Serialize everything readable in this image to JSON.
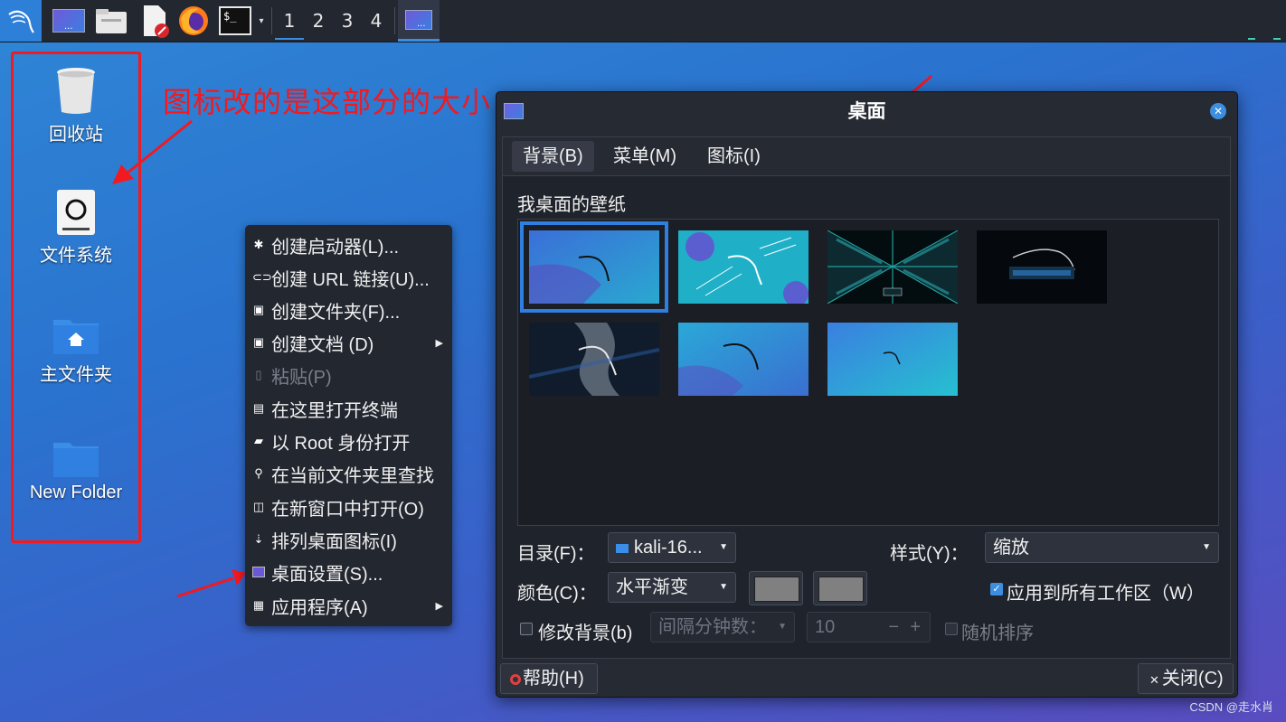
{
  "taskbar": {
    "workspaces": [
      "1",
      "2",
      "3",
      "4"
    ],
    "active_workspace": "1",
    "terminal_label": "$_"
  },
  "desktop": {
    "icons": [
      {
        "label": "回收站",
        "icon": "trash-icon"
      },
      {
        "label": "文件系统",
        "icon": "drive-icon"
      },
      {
        "label": "主文件夹",
        "icon": "home-folder-icon"
      },
      {
        "label": "New Folder",
        "icon": "folder-icon"
      }
    ],
    "annotation": "图标改的是这部分的大小",
    "annotation_color": "#f2191f"
  },
  "context_menu": {
    "items": [
      {
        "label": "创建启动器(L)...",
        "icon": "gear-icon"
      },
      {
        "label": "创建 URL 链接(U)...",
        "icon": "link-icon"
      },
      {
        "label": "创建文件夹(F)...",
        "icon": "new-folder-icon"
      },
      {
        "label": "创建文档 (D)",
        "icon": "new-document-icon",
        "submenu": true
      },
      {
        "label": "粘贴(P)",
        "icon": "paste-icon",
        "disabled": true
      },
      {
        "label": "在这里打开终端",
        "icon": "terminal-icon"
      },
      {
        "label": "以 Root 身份打开",
        "icon": "folder-icon"
      },
      {
        "label": "在当前文件夹里查找",
        "icon": "search-icon"
      },
      {
        "label": "在新窗口中打开(O)",
        "icon": "window-icon"
      },
      {
        "label": "排列桌面图标(I)",
        "icon": "arrange-icon"
      },
      {
        "label": "桌面设置(S)...",
        "icon": "desktop-settings-icon"
      },
      {
        "label": "应用程序(A)",
        "icon": "applications-icon",
        "submenu": true
      }
    ]
  },
  "dialog": {
    "title": "桌面",
    "tabs": [
      "背景(B)",
      "菜单(M)",
      "图标(I)"
    ],
    "active_tab": "背景(B)",
    "wallpaper_label": "我桌面的壁纸",
    "folder_label": "目录(F)：",
    "folder_value": "kali-16...",
    "style_label": "样式(Y)：",
    "style_value": "缩放",
    "color_label": "颜色(C)：",
    "color_value": "水平渐变",
    "color1": "#808080",
    "color2": "#808080",
    "apply_all_label": "应用到所有工作区（W）",
    "apply_all_checked": true,
    "change_bg_label": "修改背景(b)",
    "change_bg_checked": false,
    "interval_label": "间隔分钟数：",
    "interval_value": "10",
    "random_label": "随机排序",
    "random_checked": false,
    "help_button": "帮助(H)",
    "close_button": "关闭(C)"
  },
  "watermark": "CSDN @走水肖",
  "accent_color": "#3d8ee0"
}
